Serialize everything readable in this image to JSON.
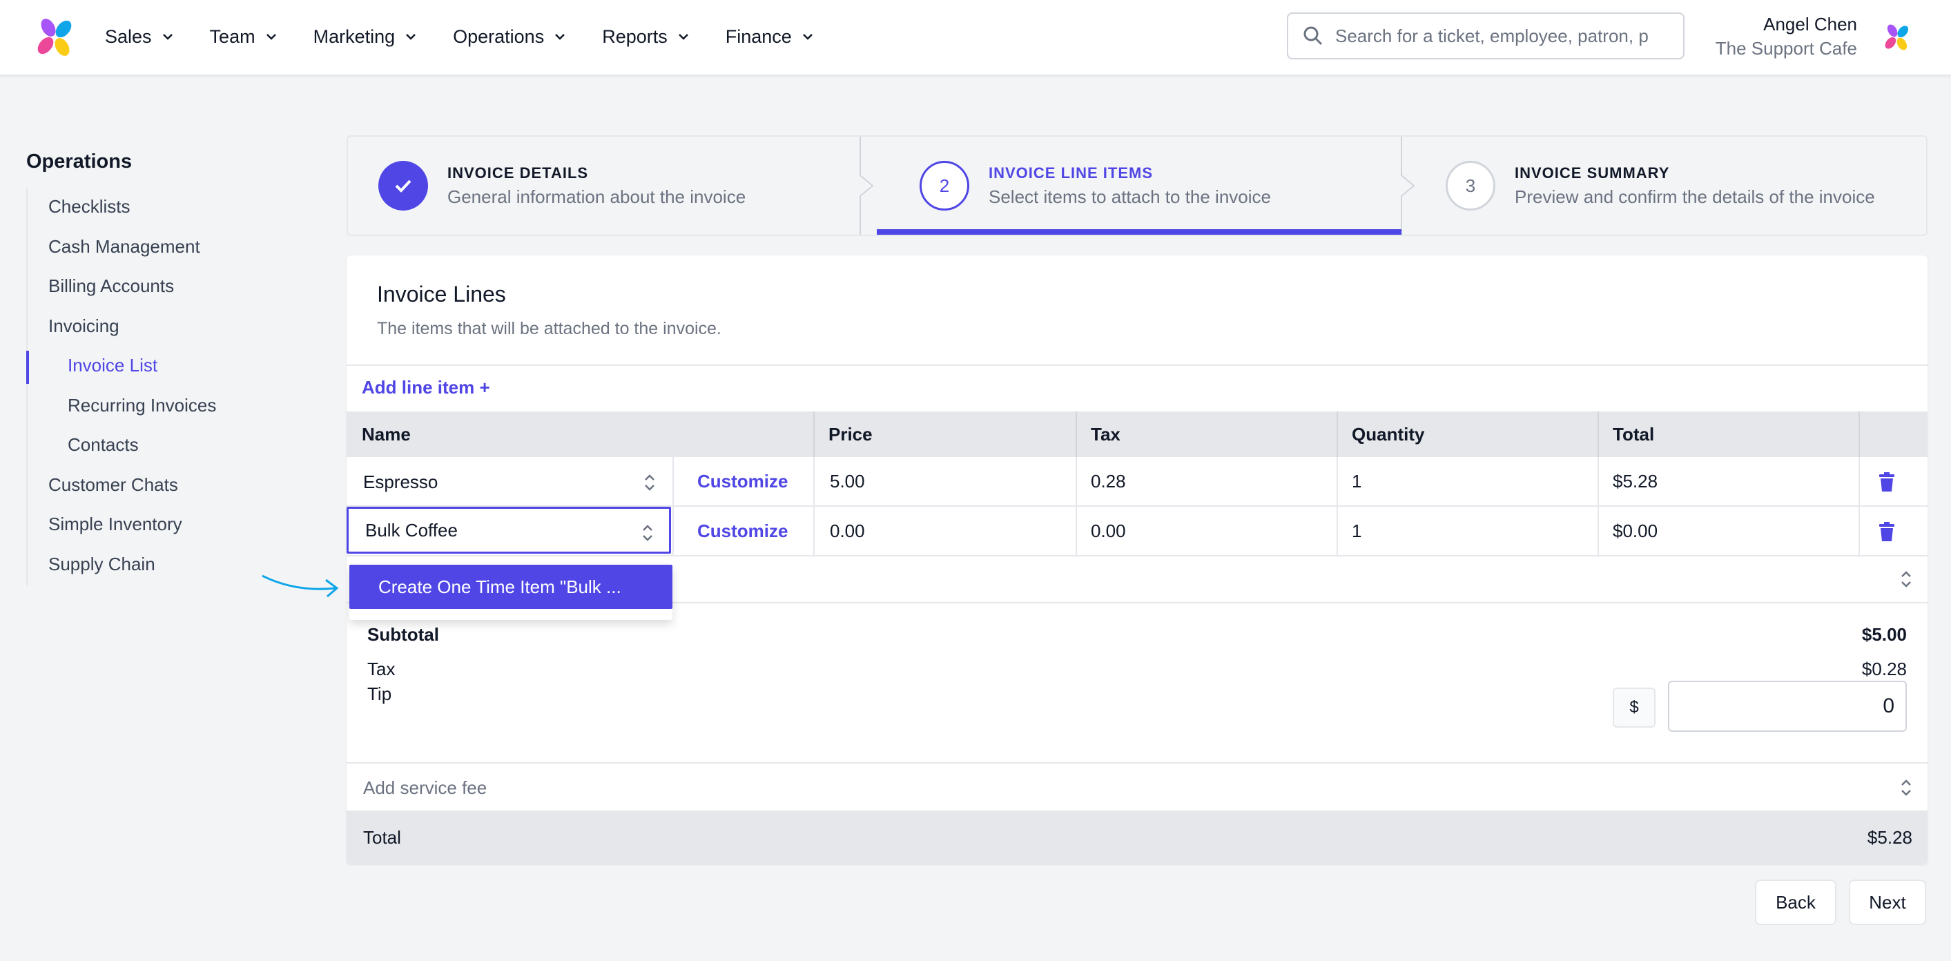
{
  "nav": {
    "items": [
      "Sales",
      "Team",
      "Marketing",
      "Operations",
      "Reports",
      "Finance"
    ],
    "search_placeholder": "Search for a ticket, employee, patron, p",
    "user_name": "Angel Chen",
    "user_org": "The Support Cafe"
  },
  "sidebar": {
    "title": "Operations",
    "items": [
      "Checklists",
      "Cash Management",
      "Billing Accounts",
      "Invoicing",
      "Invoice List",
      "Recurring Invoices",
      "Contacts",
      "Customer Chats",
      "Simple Inventory",
      "Supply Chain"
    ],
    "active": "Invoice List"
  },
  "steps": [
    {
      "title": "INVOICE DETAILS",
      "desc": "General information about the invoice",
      "status": "complete",
      "number": ""
    },
    {
      "title": "INVOICE LINE ITEMS",
      "desc": "Select items to attach to the invoice",
      "status": "current",
      "number": "2"
    },
    {
      "title": "INVOICE SUMMARY",
      "desc": "Preview and confirm the details of the invoice",
      "status": "upcoming",
      "number": "3"
    }
  ],
  "card": {
    "title": "Invoice Lines",
    "subtitle": "The items that will be attached to the invoice.",
    "add_line_label": "Add line item +",
    "customize_label": "Customize",
    "columns": [
      "Name",
      "Price",
      "Tax",
      "Quantity",
      "Total"
    ],
    "rows": [
      {
        "name": "Espresso",
        "price": "5.00",
        "tax": "0.28",
        "quantity": "1",
        "total": "$5.28"
      },
      {
        "name": "Bulk Coffee",
        "price": "0.00",
        "tax": "0.00",
        "quantity": "1",
        "total": "$0.00"
      }
    ],
    "dropdown_option": "Create One Time Item \"Bulk ...",
    "subtotal_label": "Subtotal",
    "subtotal_value": "$5.00",
    "tax_label": "Tax",
    "tax_value": "$0.28",
    "tip_label": "Tip",
    "tip_currency": "$",
    "tip_value": "0",
    "service_fee_placeholder": "Add service fee",
    "total_label": "Total",
    "total_value": "$5.28"
  },
  "buttons": {
    "back": "Back",
    "next": "Next"
  },
  "colors": {
    "accent": "#4f46e5",
    "annotation_arrow": "#0ea5e9"
  }
}
